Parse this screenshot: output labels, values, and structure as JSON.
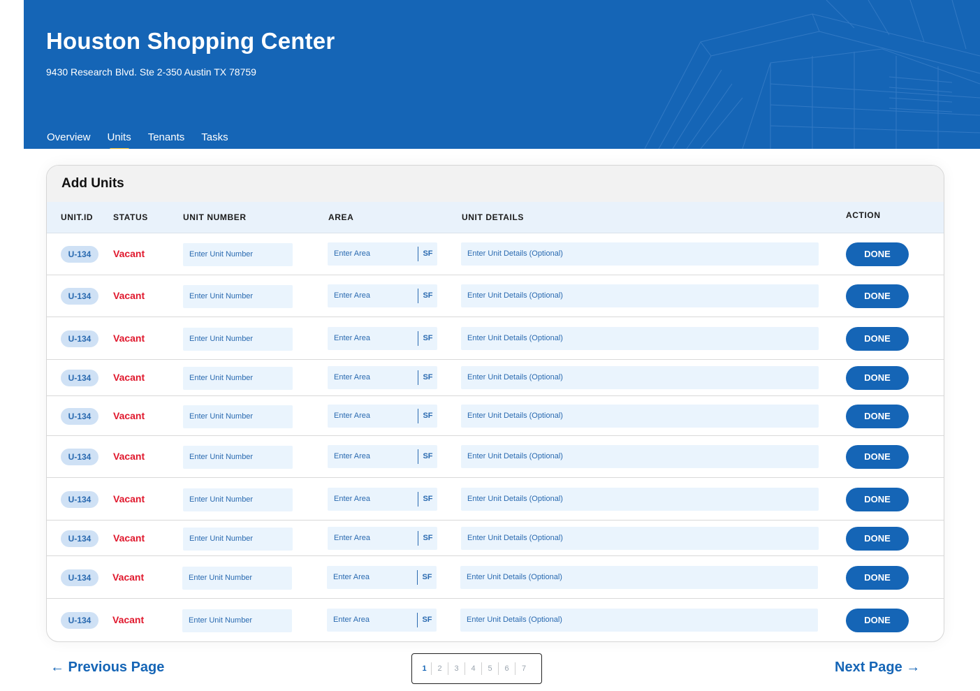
{
  "header": {
    "title": "Houston Shopping Center",
    "address": "9430 Research Blvd. Ste 2-350 Austin TX 78759",
    "tabs": [
      {
        "label": "Overview",
        "active": false
      },
      {
        "label": "Units",
        "active": true
      },
      {
        "label": "Tenants",
        "active": false
      },
      {
        "label": "Tasks",
        "active": false
      }
    ],
    "bg_color": "#1565b6",
    "tab_indicator_color": "#f4c430"
  },
  "card": {
    "title": "Add Units",
    "columns": {
      "unit_id": "UNIT.ID",
      "status": "STATUS",
      "unit_number": "UNIT NUMBER",
      "area": "AREA",
      "unit_details": "UNIT DETAILS",
      "action": "ACTION"
    },
    "rows": [
      {
        "unit_id": "U-134",
        "status": "Vacant",
        "unit_number_placeholder": "Enter Unit Number",
        "area_placeholder": "Enter Area",
        "area_unit": "SF",
        "details_placeholder": "Enter Unit Details (Optional)",
        "action": "DONE"
      },
      {
        "unit_id": "U-134",
        "status": "Vacant",
        "unit_number_placeholder": "Enter Unit Number",
        "area_placeholder": "Enter Area",
        "area_unit": "SF",
        "details_placeholder": "Enter Unit Details (Optional)",
        "action": "DONE"
      },
      {
        "unit_id": "U-134",
        "status": "Vacant",
        "unit_number_placeholder": "Enter Unit Number",
        "area_placeholder": "Enter Area",
        "area_unit": "SF",
        "details_placeholder": "Enter Unit Details (Optional)",
        "action": "DONE"
      },
      {
        "unit_id": "U-134",
        "status": "Vacant",
        "unit_number_placeholder": "Enter Unit Number",
        "area_placeholder": "Enter Area",
        "area_unit": "SF",
        "details_placeholder": "Enter Unit Details (Optional)",
        "action": "DONE"
      },
      {
        "unit_id": "U-134",
        "status": "Vacant",
        "unit_number_placeholder": "Enter Unit Number",
        "area_placeholder": "Enter Area",
        "area_unit": "SF",
        "details_placeholder": "Enter Unit Details (Optional)",
        "action": "DONE"
      },
      {
        "unit_id": "U-134",
        "status": "Vacant",
        "unit_number_placeholder": "Enter Unit Number",
        "area_placeholder": "Enter Area",
        "area_unit": "SF",
        "details_placeholder": "Enter Unit Details (Optional)",
        "action": "DONE"
      },
      {
        "unit_id": "U-134",
        "status": "Vacant",
        "unit_number_placeholder": "Enter Unit Number",
        "area_placeholder": "Enter Area",
        "area_unit": "SF",
        "details_placeholder": "Enter Unit Details (Optional)",
        "action": "DONE"
      },
      {
        "unit_id": "U-134",
        "status": "Vacant",
        "unit_number_placeholder": "Enter Unit Number",
        "area_placeholder": "Enter Area",
        "area_unit": "SF",
        "details_placeholder": "Enter Unit Details (Optional)",
        "action": "DONE"
      },
      {
        "unit_id": "U-134",
        "status": "Vacant",
        "unit_number_placeholder": "Enter Unit Number",
        "area_placeholder": "Enter Area",
        "area_unit": "SF",
        "details_placeholder": "Enter Unit Details (Optional)",
        "action": "DONE"
      },
      {
        "unit_id": "U-134",
        "status": "Vacant",
        "unit_number_placeholder": "Enter Unit Number",
        "area_placeholder": "Enter Area",
        "area_unit": "SF",
        "details_placeholder": "Enter Unit Details (Optional)",
        "action": "DONE"
      }
    ],
    "status_color": "#e0182d",
    "button_color": "#1565b6"
  },
  "pagination": {
    "prev_label": "← Previous Page",
    "next_label": "Next Page →",
    "pages": [
      "1",
      "2",
      "3",
      "4",
      "5",
      "6",
      "7"
    ],
    "current_page": "1"
  }
}
